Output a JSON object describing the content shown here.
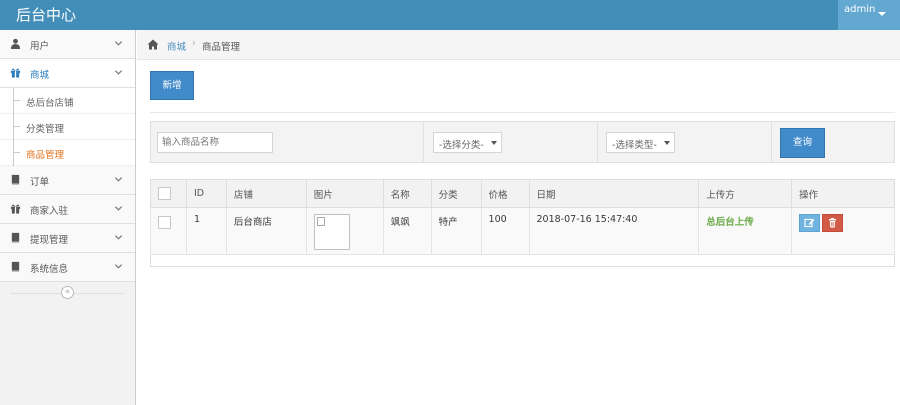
{
  "app": {
    "title": "后台中心"
  },
  "user": {
    "name": "admin"
  },
  "sidebar": {
    "items": [
      {
        "label": "用户",
        "icon": "user-icon",
        "open": false
      },
      {
        "label": "商城",
        "icon": "gift-icon",
        "open": true,
        "children": [
          {
            "label": "总后台店铺",
            "active": false
          },
          {
            "label": "分类管理",
            "active": false
          },
          {
            "label": "商品管理",
            "active": true
          }
        ]
      },
      {
        "label": "订单",
        "icon": "book-icon",
        "open": false
      },
      {
        "label": "商家入驻",
        "icon": "gift-icon",
        "open": false
      },
      {
        "label": "提现管理",
        "icon": "book-icon",
        "open": false
      },
      {
        "label": "系统信息",
        "icon": "book-icon",
        "open": false
      }
    ],
    "collapse_glyph": "«"
  },
  "breadcrumb": {
    "home": "商城",
    "separator": "›",
    "current": "商品管理"
  },
  "toolbar": {
    "add_label": "新增"
  },
  "search": {
    "name_placeholder": "输入商品名称",
    "category_value": "-选择分类-",
    "type_value": "-选择类型-",
    "query_label": "查询"
  },
  "table": {
    "columns": [
      "",
      "ID",
      "店铺",
      "图片",
      "名称",
      "分类",
      "价格",
      "日期",
      "上传方",
      "操作"
    ],
    "rows": [
      {
        "id": "1",
        "shop": "后台商店",
        "name": "飒飒",
        "category": "特产",
        "price": "100",
        "date": "2018-07-16 15:47:40",
        "uploader": "总后台上传"
      }
    ]
  },
  "colors": {
    "topbar": "#438eb9",
    "accent": "#428bca",
    "active_sub": "#e2731f",
    "uploader": "#69aa46",
    "edit": "#6fb3e0",
    "delete": "#d15b47"
  }
}
